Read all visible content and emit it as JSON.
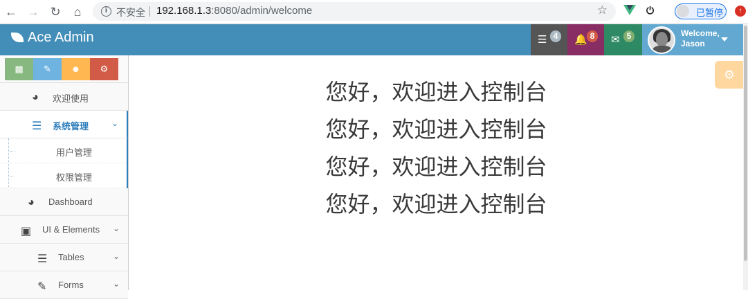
{
  "browser": {
    "insecure_label": "不安全",
    "url_host": "192.168.1.3",
    "url_rest": ":8080/admin/welcome",
    "paused_label": "已暂停"
  },
  "navbar": {
    "brand": "Ace Admin",
    "tasks_count": "4",
    "notifications_count": "8",
    "messages_count": "5",
    "welcome_line1": "Welcome,",
    "welcome_line2": "Jason",
    "colors": {
      "bar": "#438eb9",
      "tasks": "#555555",
      "notifications": "#892e65",
      "messages": "#2e8965",
      "user": "#62a8d1"
    }
  },
  "shortcuts": {
    "colors": [
      "#87b87f",
      "#6fb3e0",
      "#ffb752",
      "#d15b47"
    ],
    "icons": [
      "signal-icon",
      "pencil-icon",
      "users-icon",
      "cogs-icon"
    ]
  },
  "sidebar": {
    "items": [
      {
        "label": "欢迎使用",
        "icon": "tachometer-icon"
      },
      {
        "label": "系统管理",
        "icon": "list-icon",
        "expanded": true
      },
      {
        "label": "Dashboard",
        "icon": "tachometer-icon"
      },
      {
        "label": "UI & Elements",
        "icon": "desktop-icon"
      },
      {
        "label": "Tables",
        "icon": "list-icon"
      },
      {
        "label": "Forms",
        "icon": "pencil-square-icon"
      }
    ],
    "subitems": [
      {
        "label": "用户管理"
      },
      {
        "label": "权限管理"
      }
    ]
  },
  "main": {
    "greetings": [
      "您好，欢迎进入控制台",
      "您好，欢迎进入控制台",
      "您好，欢迎进入控制台",
      "您好，欢迎进入控制台"
    ]
  }
}
